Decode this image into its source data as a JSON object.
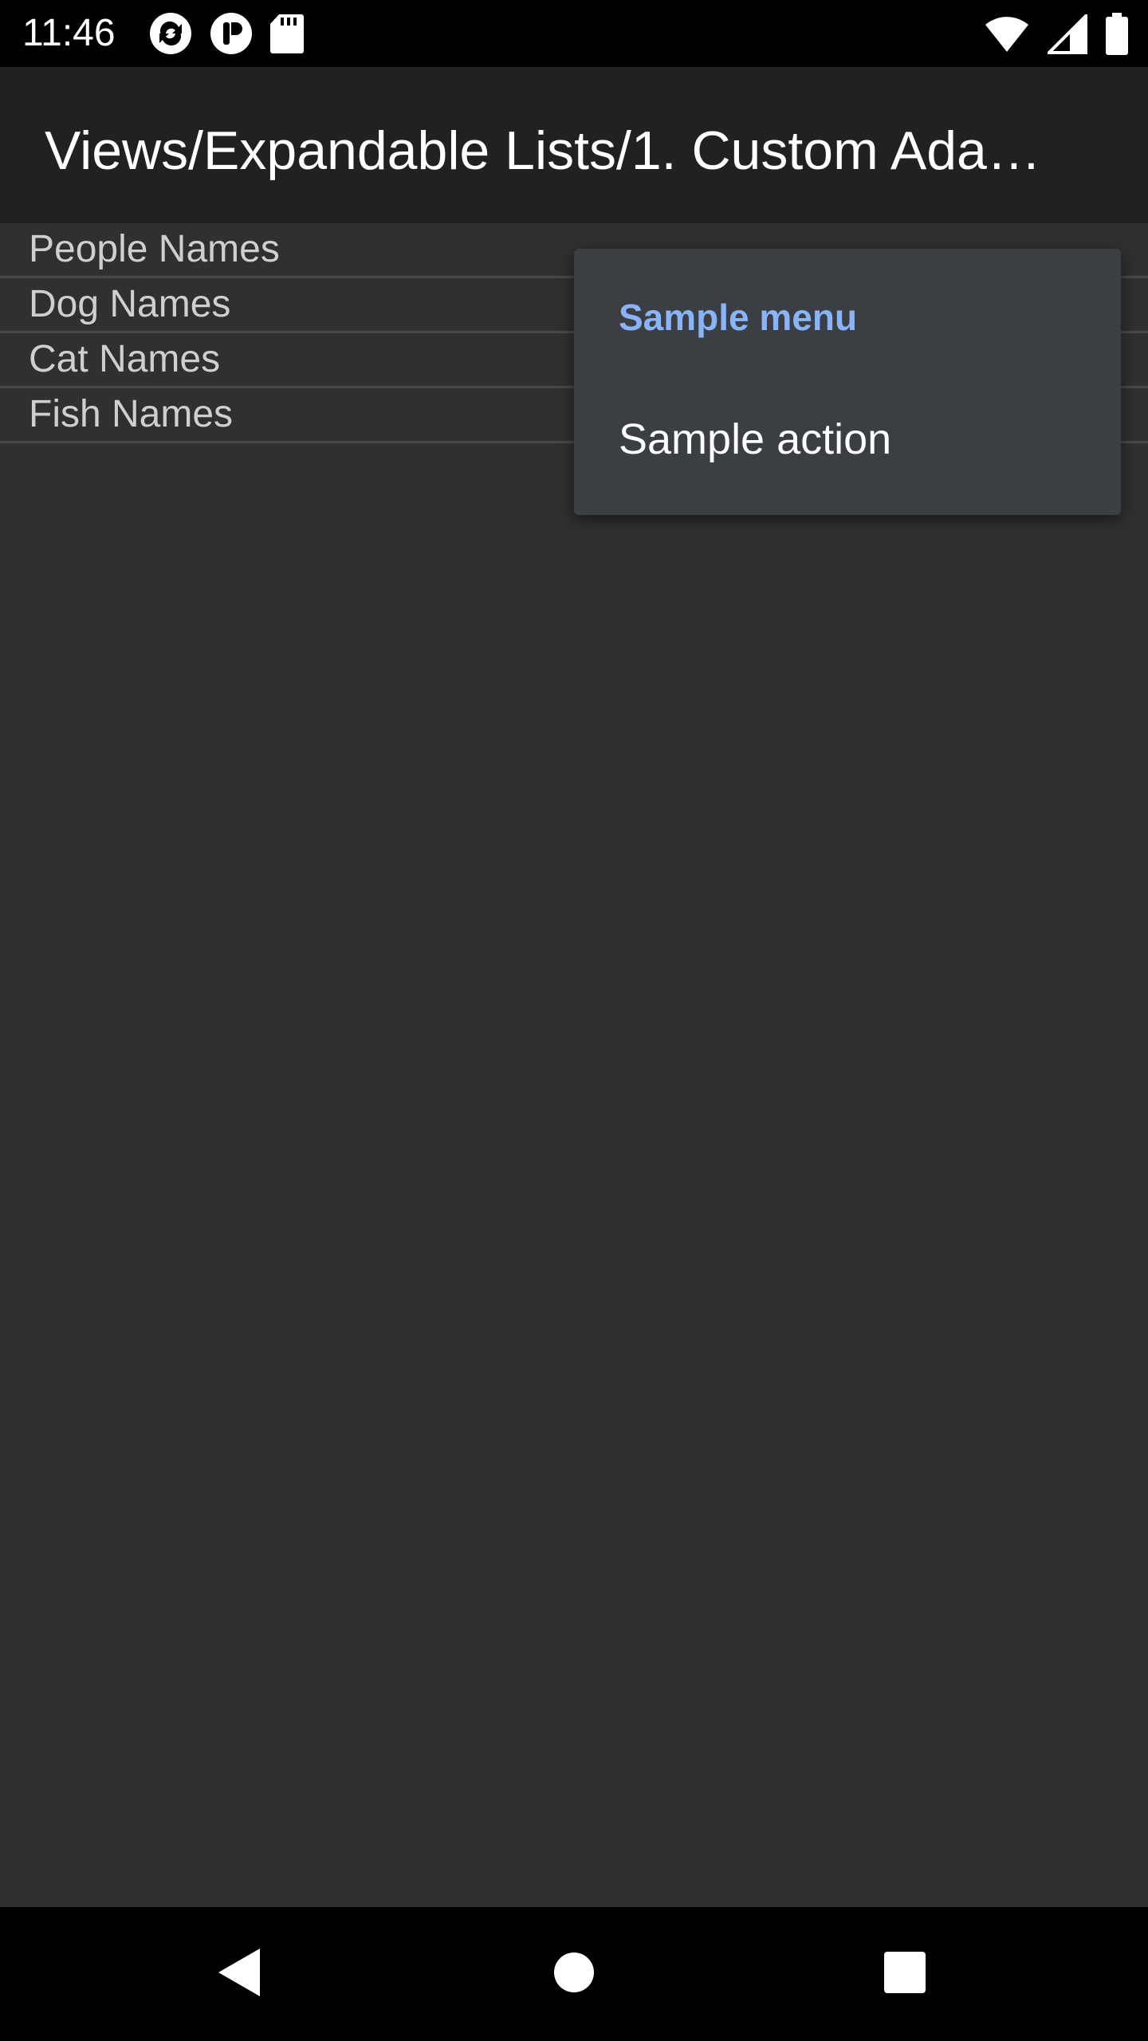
{
  "status_bar": {
    "time": "11:46",
    "left_icons": [
      "sync-icon",
      "app-notification-icon",
      "sd-card-icon"
    ],
    "right_icons": [
      "wifi-icon",
      "cellular-signal-icon",
      "battery-icon"
    ]
  },
  "app_bar": {
    "title": "Views/Expandable Lists/1. Custom Ada…"
  },
  "list": {
    "items": [
      {
        "label": "People Names"
      },
      {
        "label": "Dog Names"
      },
      {
        "label": "Cat Names"
      },
      {
        "label": "Fish Names"
      }
    ]
  },
  "popup_menu": {
    "header": "Sample menu",
    "items": [
      {
        "label": "Sample action"
      }
    ]
  },
  "nav_bar": {
    "icons": [
      "back-icon",
      "home-icon",
      "recents-icon"
    ]
  },
  "colors": {
    "background": "#303030",
    "app_bar": "#212121",
    "menu_background": "#3b3e42",
    "menu_header": "#8ab4f8"
  }
}
